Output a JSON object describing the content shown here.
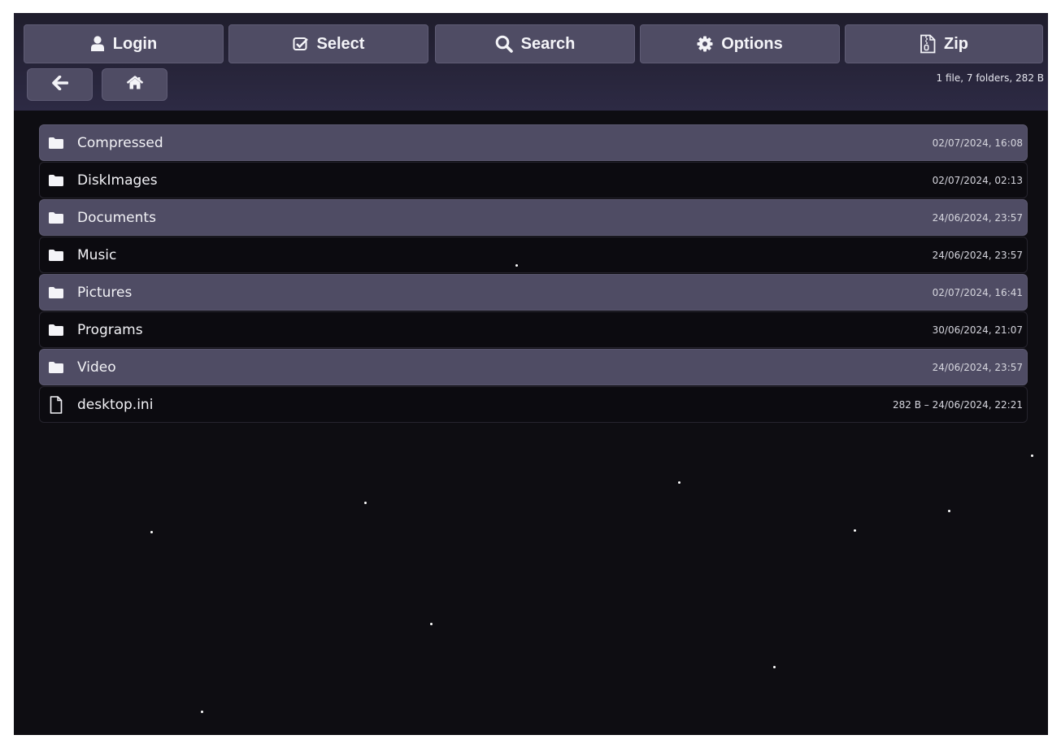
{
  "toolbar": {
    "buttons": [
      {
        "label": "Login",
        "icon": "user-icon"
      },
      {
        "label": "Select",
        "icon": "check-square-icon"
      },
      {
        "label": "Search",
        "icon": "search-icon"
      },
      {
        "label": "Options",
        "icon": "gear-icon"
      },
      {
        "label": "Zip",
        "icon": "zip-file-icon"
      }
    ]
  },
  "nav": {
    "back_icon": "arrow-left-icon",
    "home_icon": "home-icon"
  },
  "summary": "1 file, 7 folders, 282 B",
  "entries": [
    {
      "type": "folder",
      "icon": "folder-icon",
      "name": "Compressed",
      "meta": "02/07/2024, 16:08"
    },
    {
      "type": "folder",
      "icon": "folder-icon",
      "name": "DiskImages",
      "meta": "02/07/2024, 02:13"
    },
    {
      "type": "folder",
      "icon": "folder-icon",
      "name": "Documents",
      "meta": "24/06/2024, 23:57"
    },
    {
      "type": "folder",
      "icon": "folder-icon",
      "name": "Music",
      "meta": "24/06/2024, 23:57"
    },
    {
      "type": "folder",
      "icon": "folder-icon",
      "name": "Pictures",
      "meta": "02/07/2024, 16:41"
    },
    {
      "type": "folder",
      "icon": "folder-icon",
      "name": "Programs",
      "meta": "30/06/2024, 21:07"
    },
    {
      "type": "folder",
      "icon": "folder-icon",
      "name": "Video",
      "meta": "24/06/2024, 23:57"
    },
    {
      "type": "file",
      "icon": "file-icon",
      "name": "desktop.ini",
      "meta": "282 B – 24/06/2024, 22:21"
    }
  ],
  "colors": {
    "background": "#0e0d12",
    "row_highlight": "#4f4c64",
    "button": "#4f4c64",
    "text": "#f2f2f6"
  }
}
